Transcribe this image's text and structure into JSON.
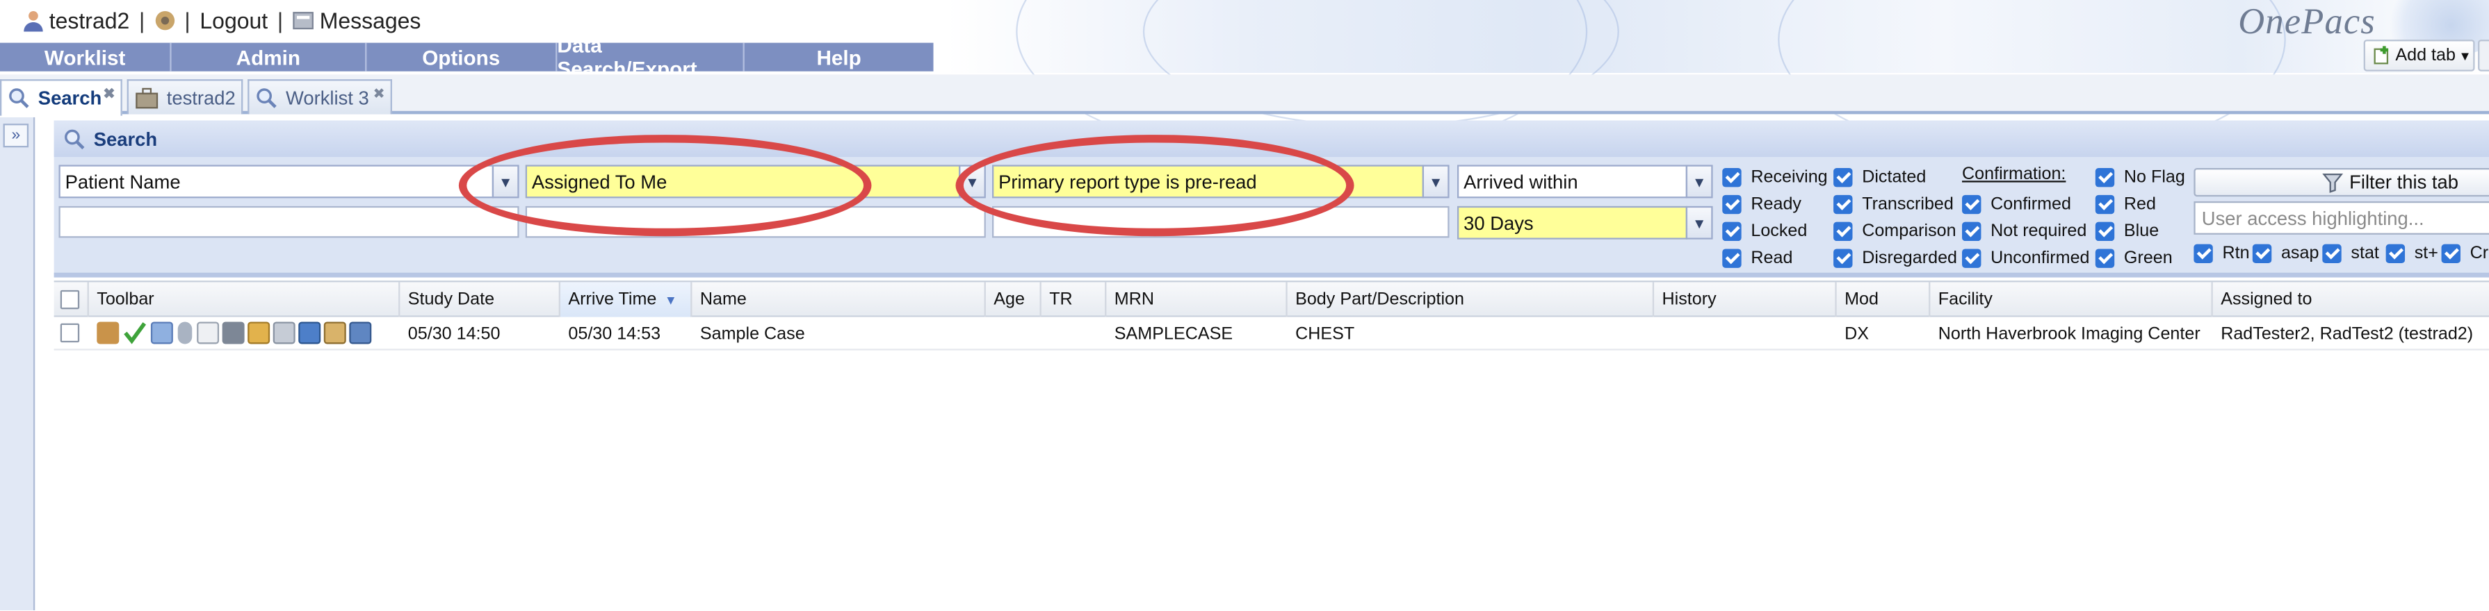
{
  "header": {
    "username": "testrad2",
    "logout": "Logout",
    "messages": "Messages",
    "logo": "OnePacs",
    "add_tab": "Add tab"
  },
  "menu": [
    "Worklist",
    "Admin",
    "Options",
    "Data Search/Export",
    "Help"
  ],
  "tabs": [
    {
      "label": "Search",
      "active": true,
      "icon": "magnifier-icon"
    },
    {
      "label": "testrad2",
      "active": false,
      "icon": "briefcase-icon"
    },
    {
      "label": "Worklist 3",
      "active": false,
      "icon": "magnifier-icon"
    }
  ],
  "search": {
    "title": "Search",
    "field1": "Patient Name",
    "field2": "Assigned To Me",
    "field3": "Primary report type is pre-read",
    "field4": "Arrived within",
    "field4_value": "30 Days",
    "status_checks": [
      "Receiving",
      "Ready",
      "Locked",
      "Read"
    ],
    "report_checks": [
      "Dictated",
      "Transcribed",
      "Comparison",
      "Disregarded"
    ],
    "confirmation_title": "Confirmation:",
    "confirmation_checks": [
      "Confirmed",
      "Not required",
      "Unconfirmed"
    ],
    "flag_checks": [
      "No Flag",
      "Red",
      "Blue",
      "Green"
    ],
    "filter_button": "Filter this tab",
    "highlight_placeholder": "User access highlighting...",
    "priority_checks": [
      "Rtn",
      "asap",
      "stat",
      "st+",
      "Cri"
    ]
  },
  "grid": {
    "columns": [
      "Toolbar",
      "Study Date",
      "Arrive Time",
      "Name",
      "Age",
      "TR",
      "MRN",
      "Body Part/Description",
      "History",
      "Mod",
      "Facility",
      "Assigned to"
    ],
    "sorted_column": "Arrive Time",
    "rows": [
      {
        "study_date": "05/30 14:50",
        "arrive_time": "05/30 14:53",
        "name": "Sample Case",
        "age": "",
        "tr": "",
        "mrn": "SAMPLECASE",
        "body_part": "CHEST",
        "history": "",
        "mod": "DX",
        "facility": "North Haverbrook Imaging Center",
        "assigned_to": "RadTester2, RadTest2 (testrad2)"
      }
    ]
  },
  "colors": {
    "menu_bg": "#7d8fc1",
    "highlight_yellow": "#ffff99",
    "annotation_red": "#d94848",
    "checkbox_blue": "#2f74d7"
  }
}
